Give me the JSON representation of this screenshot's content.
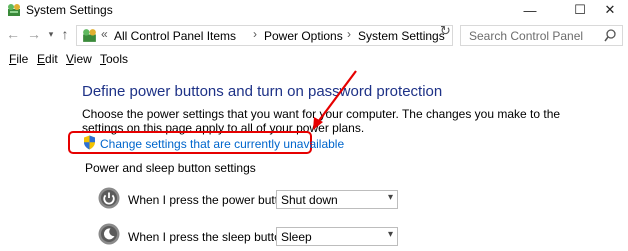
{
  "window": {
    "title": "System Settings",
    "minimize_glyph": "—",
    "maximize_glyph": "☐",
    "close_glyph": "✕"
  },
  "nav": {
    "back_glyph": "←",
    "forward_glyph": "→",
    "recent_glyph": "▾",
    "up_glyph": "↑"
  },
  "address": {
    "prefix": "«",
    "crumbs": [
      "All Control Panel Items",
      "Power Options",
      "System Settings"
    ],
    "separator": "›",
    "dropdown_glyph": "▾",
    "refresh_glyph": "↻"
  },
  "search": {
    "placeholder": "Search Control Panel"
  },
  "menu": [
    {
      "key": "F",
      "rest": "ile"
    },
    {
      "key": "E",
      "rest": "dit"
    },
    {
      "key": "V",
      "rest": "iew"
    },
    {
      "key": "T",
      "rest": "ools"
    }
  ],
  "page": {
    "heading": "Define power buttons and turn on password protection",
    "description": "Choose the power settings that you want for your computer. The changes you make to the settings on this page apply to all of your power plans.",
    "change_link": "Change settings that are currently unavailable",
    "section_label": "Power and sleep button settings",
    "rows": [
      {
        "label": "When I press the power button:",
        "value": "Shut down",
        "icon": "power-icon"
      },
      {
        "label": "When I press the sleep button:",
        "value": "Sleep",
        "icon": "sleep-icon"
      }
    ],
    "select_arrow": "▾"
  },
  "colors": {
    "heading": "#1e3287",
    "link": "#0066cc",
    "annotation_red": "#e60000"
  }
}
